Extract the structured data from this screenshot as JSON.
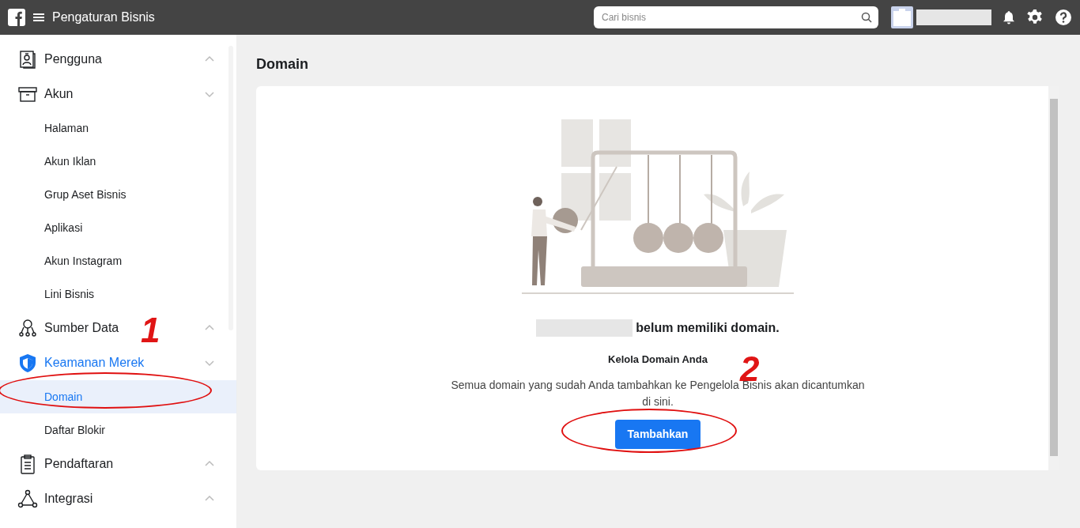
{
  "topbar": {
    "title": "Pengaturan Bisnis",
    "search": {
      "placeholder": "Cari bisnis"
    }
  },
  "sidebar": {
    "items": [
      {
        "label": "Pengguna",
        "expanded": false,
        "selected": false
      },
      {
        "label": "Akun",
        "expanded": true,
        "selected": false,
        "children": [
          {
            "label": "Halaman",
            "selected": false
          },
          {
            "label": "Akun Iklan",
            "selected": false
          },
          {
            "label": "Grup Aset Bisnis",
            "selected": false
          },
          {
            "label": "Aplikasi",
            "selected": false
          },
          {
            "label": "Akun Instagram",
            "selected": false
          },
          {
            "label": "Lini Bisnis",
            "selected": false
          }
        ]
      },
      {
        "label": "Sumber Data",
        "expanded": false,
        "selected": false
      },
      {
        "label": "Keamanan Merek",
        "expanded": true,
        "selected": true,
        "children": [
          {
            "label": "Domain",
            "selected": true
          },
          {
            "label": "Daftar Blokir",
            "selected": false
          }
        ]
      },
      {
        "label": "Pendaftaran",
        "expanded": false,
        "selected": false
      },
      {
        "label": "Integrasi",
        "expanded": false,
        "selected": false
      }
    ]
  },
  "page_title": "Domain",
  "empty_state": {
    "heading": "belum memiliki domain.",
    "subheading": "Kelola Domain Anda",
    "description": "Semua domain yang sudah Anda tambahkan ke Pengelola Bisnis akan dicantumkan di sini.",
    "button": "Tambahkan"
  },
  "annotations": [
    {
      "label": "1"
    },
    {
      "label": "2"
    }
  ]
}
